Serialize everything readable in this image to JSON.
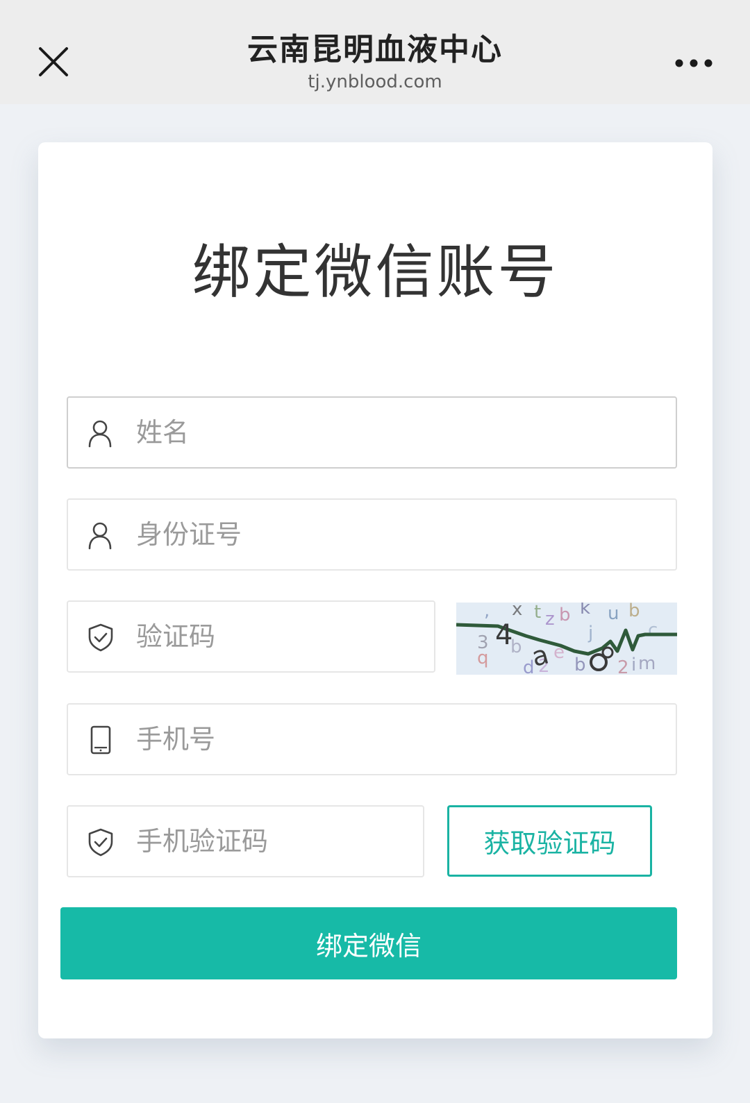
{
  "header": {
    "title": "云南昆明血液中心",
    "url": "tj.ynblood.com",
    "close_icon": "close-icon",
    "more_icon": "more-dots-icon"
  },
  "form": {
    "heading": "绑定微信账号",
    "name_placeholder": "姓名",
    "id_placeholder": "身份证号",
    "captcha_placeholder": "验证码",
    "phone_placeholder": "手机号",
    "sms_code_placeholder": "手机验证码",
    "sms_button_label": "获取验证码",
    "submit_label": "绑定微信"
  },
  "colors": {
    "accent": "#17baa7",
    "accent_border": "#1ab3a3",
    "topbar": "#ededed",
    "page_bg": "#eef1f5"
  }
}
